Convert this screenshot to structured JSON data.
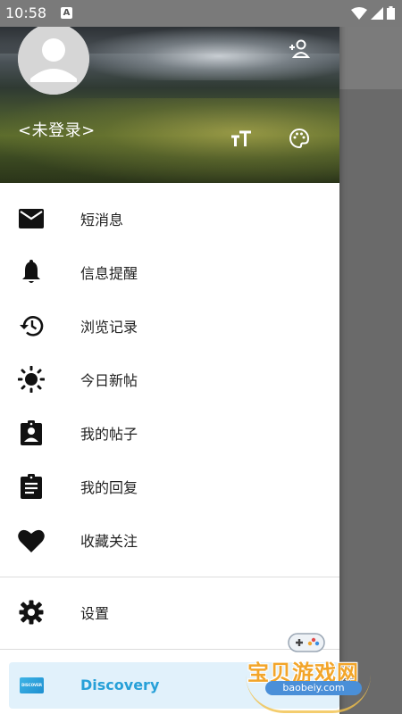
{
  "status_bar": {
    "time": "10:58",
    "notification_letter": "A"
  },
  "header": {
    "login_label": "<未登录>"
  },
  "menu": [
    {
      "label": "短消息",
      "icon": "mail-icon"
    },
    {
      "label": "信息提醒",
      "icon": "bell-icon"
    },
    {
      "label": "浏览记录",
      "icon": "history-icon"
    },
    {
      "label": "今日新帖",
      "icon": "brightness-icon"
    },
    {
      "label": "我的帖子",
      "icon": "assignment-person-icon"
    },
    {
      "label": "我的回复",
      "icon": "clipboard-icon"
    },
    {
      "label": "收藏关注",
      "icon": "heart-icon"
    }
  ],
  "settings": {
    "label": "设置",
    "icon": "gear-icon"
  },
  "discovery": {
    "label": "Discovery",
    "card_text": "DISCOVER"
  },
  "watermark": {
    "title": "宝贝游戏网",
    "url": "baobeiy.com"
  },
  "colors": {
    "accent": "#27a0d8",
    "discovery_bg": "#e1f1fb",
    "scrim": "#6a6a6a"
  }
}
